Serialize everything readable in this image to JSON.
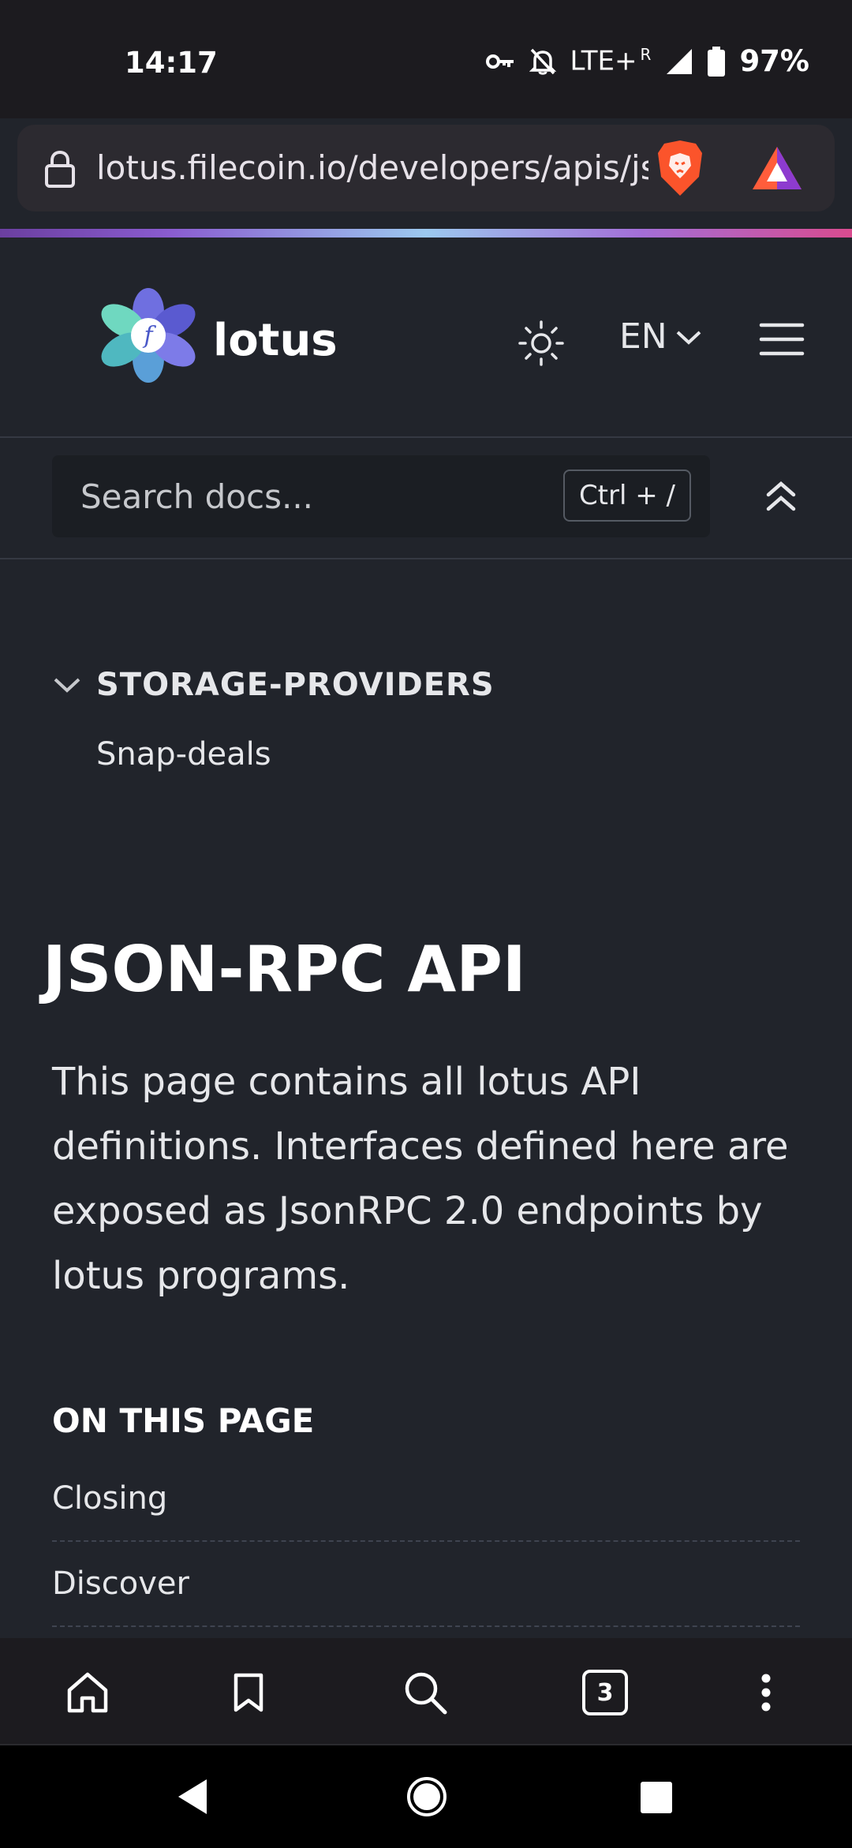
{
  "status_bar": {
    "time": "14:17",
    "network": "LTE+",
    "roaming": "R",
    "battery": "97%"
  },
  "browser": {
    "url": "lotus.filecoin.io/developers/apis/json-rpc/"
  },
  "header": {
    "logo_text": "lotus",
    "language": "EN"
  },
  "search": {
    "placeholder": "Search docs...",
    "shortcut": "Ctrl + /"
  },
  "sidebar": {
    "section_title": "STORAGE-PROVIDERS",
    "items": [
      {
        "label": "Snap-deals"
      }
    ]
  },
  "main": {
    "title": "JSON-RPC API",
    "intro": "This page contains all lotus API definitions. Interfaces defined here are exposed as JsonRPC 2.0 endpoints by lotus programs.",
    "toc_title": "ON THIS PAGE",
    "toc": [
      {
        "label": "Closing"
      },
      {
        "label": "Discover"
      }
    ]
  },
  "bottom_nav": {
    "tab_count": "3"
  },
  "colors": {
    "background": "#21242b",
    "brave_orange": "#fb542b",
    "accent_purple": "#7b68ee"
  }
}
